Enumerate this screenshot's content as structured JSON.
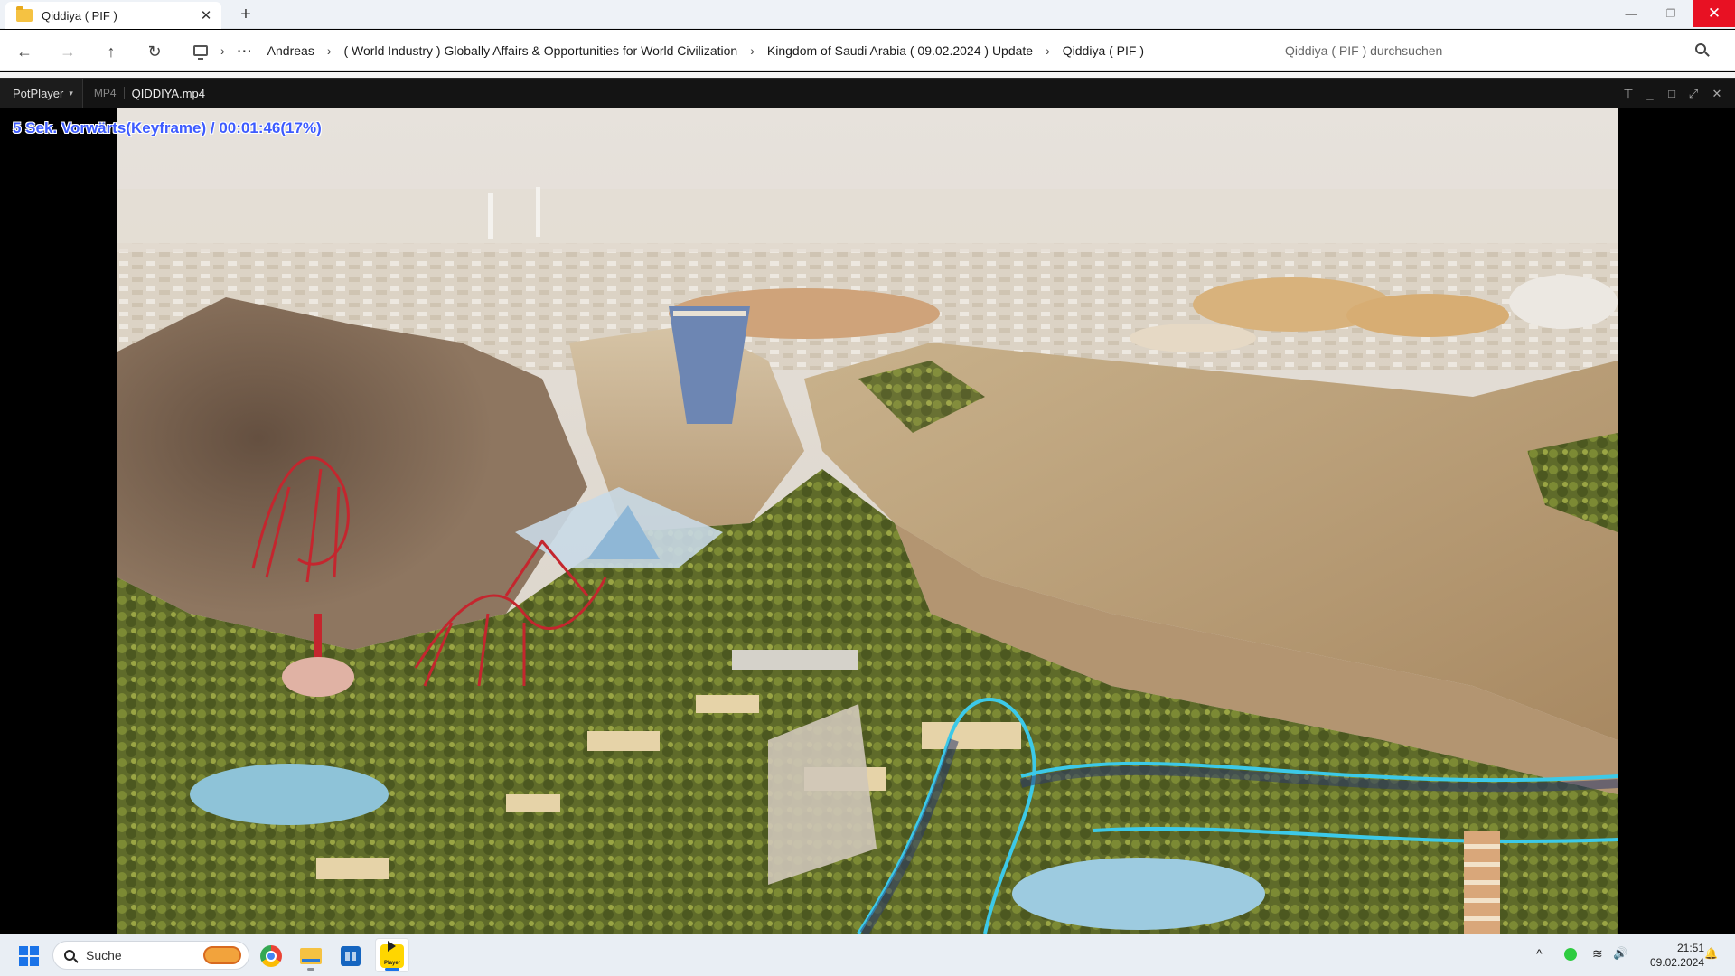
{
  "explorer": {
    "tab_title": "Qiddiya ( PIF )",
    "tab_close": "✕",
    "new_tab": "+",
    "window_controls": {
      "minimize": "—",
      "restore": "❐",
      "close": "✕"
    },
    "nav": {
      "back": "←",
      "forward": "→",
      "up": "↑",
      "refresh": "↻"
    },
    "breadcrumb": {
      "more": "···",
      "separator": "›",
      "items": [
        "Andreas",
        "( World Industry ) Globally Affairs & Opportunities for World Civilization",
        "Kingdom of Saudi Arabia ( 09.02.2024 ) Update",
        "Qiddiya ( PIF )"
      ]
    },
    "search_placeholder": "Qiddiya ( PIF ) durchsuchen"
  },
  "player": {
    "menu_label": "PotPlayer",
    "menu_caret": "▾",
    "format": "MP4",
    "filename": "QIDDIYA.mp4",
    "controls": {
      "pin": "⊤",
      "minimize": "_",
      "maximize": "□",
      "fullscreen": "⤢",
      "close": "✕"
    },
    "osd_text": "5  Sek. Vorwärts(Keyframe) / 00:01:46(17%)"
  },
  "taskbar": {
    "search_label": "Suche",
    "tray": {
      "chevron": "^",
      "wifi": "≋",
      "volume": "🔊"
    },
    "time": "21:51",
    "date": "09.02.2024",
    "bell": "🔔",
    "pot_icon_label": "Player"
  },
  "colors": {
    "osd": "#3d5bff",
    "close_button": "#e81123",
    "coaster": "#c4262e",
    "track": "#3cc9e8"
  }
}
